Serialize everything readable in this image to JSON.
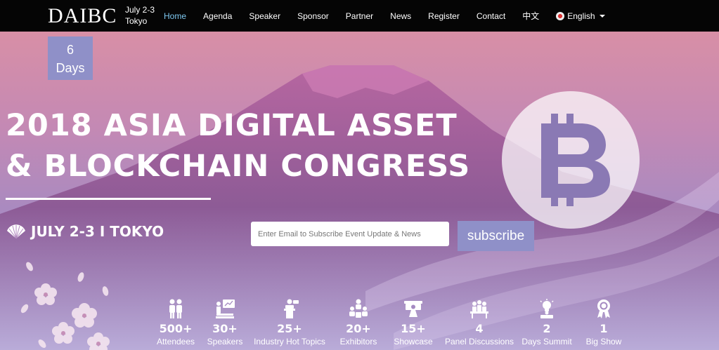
{
  "brand": {
    "logo_text": "DAIBC",
    "date_line1": "July 2-3",
    "date_line2": "Tokyo"
  },
  "nav": {
    "items": [
      {
        "label": "Home",
        "active": true
      },
      {
        "label": "Agenda"
      },
      {
        "label": "Speaker"
      },
      {
        "label": "Sponsor"
      },
      {
        "label": "Partner"
      },
      {
        "label": "News"
      },
      {
        "label": "Register"
      },
      {
        "label": "Contact"
      },
      {
        "label": "中文"
      }
    ],
    "language": "English"
  },
  "countdown": {
    "value": "6",
    "unit": "Days"
  },
  "hero": {
    "title_line1": "2018  ASIA DIGITAL ASSET",
    "title_line2": "& BLOCKCHAIN CONGRESS",
    "date_location": "JULY 2-3 I TOKYO"
  },
  "subscribe": {
    "placeholder": "Enter Email to Subscribe Event Update & News",
    "button_label": "subscribe"
  },
  "stats": [
    {
      "value": "500+",
      "label": "Attendees",
      "icon": "people-icon"
    },
    {
      "value": "30+",
      "label": "Speakers",
      "icon": "presentation-icon"
    },
    {
      "value": "25+",
      "label": "Industry Hot Topics",
      "icon": "speaker-podium-icon"
    },
    {
      "value": "20+",
      "label": "Exhibitors",
      "icon": "group-icon"
    },
    {
      "value": "15+",
      "label": "Showcase",
      "icon": "projector-icon"
    },
    {
      "value": "4",
      "label": "Panel Discussions",
      "icon": "panel-icon"
    },
    {
      "value": "2",
      "label": "Days Summit",
      "icon": "idea-icon"
    },
    {
      "value": "1",
      "label": "Big Show",
      "icon": "award-icon"
    }
  ],
  "colors": {
    "accent": "#8f90c8",
    "nav_bg": "#050505",
    "active_link": "#7ec8f0"
  }
}
